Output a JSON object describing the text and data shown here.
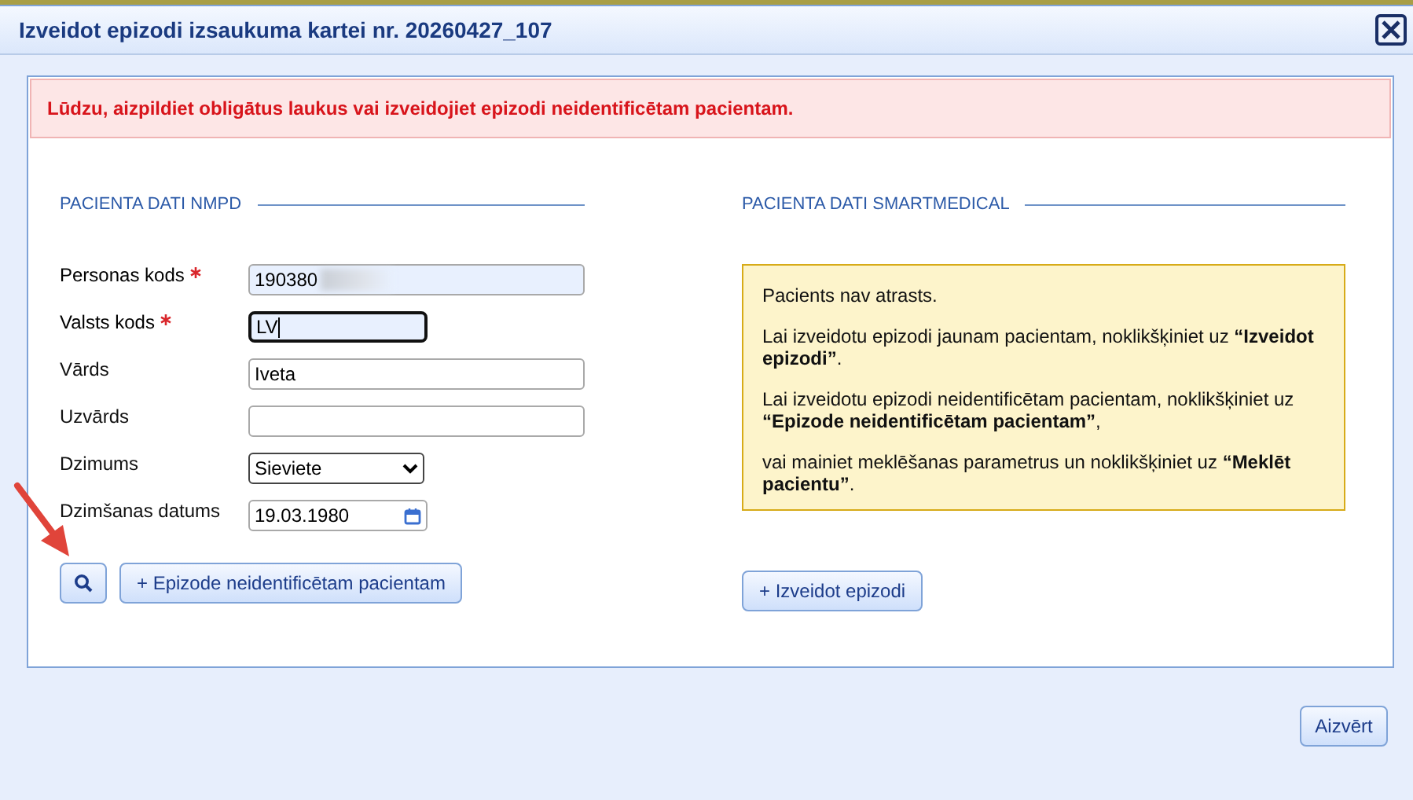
{
  "window": {
    "title": "Izveidot epizodi izsaukuma kartei nr. 20260427_107"
  },
  "alert": "Lūdzu, aizpildiet obligātus laukus vai izveidojiet epizodi neidentificētam pacientam.",
  "nmpd": {
    "heading": "PACIENTA DATI NMPD",
    "fields": [
      {
        "label": "Personas kods",
        "kind": "text",
        "value": "190380",
        "required": true,
        "focused": false,
        "autofilled": true,
        "redacted": true
      },
      {
        "label": "Valsts kods",
        "kind": "text",
        "value": "LV",
        "required": true,
        "focused": true,
        "autofilled": true,
        "redacted": false
      },
      {
        "label": "Vārds",
        "kind": "text",
        "value": "Iveta",
        "required": false,
        "focused": false,
        "autofilled": false,
        "redacted": false
      },
      {
        "label": "Uzvārds",
        "kind": "text",
        "required": false,
        "focused": false,
        "autofilled": false,
        "redacted": false
      },
      {
        "label": "Dzimums",
        "kind": "select",
        "value": "Sieviete",
        "required": false
      },
      {
        "label": "Dzimšanas datums",
        "kind": "date",
        "value": "19.03.1980",
        "required": false
      }
    ],
    "unidentified_button": "+ Epizode neidentificētam pacientam"
  },
  "smartmedical": {
    "heading": "PACIENTA DATI SMARTMEDICAL",
    "messages": [
      "Pacients nav atrasts.",
      "Lai izveidotu epizodi jaunam pacientam, noklikšķiniet uz **“Izveidot epizodi”**.",
      "Lai izveidotu epizodi neidentificētam pacientam, noklikšķiniet uz **“Epizode neidentificētam pacientam”**,",
      "vai mainiet meklēšanas parametrus un noklikšķiniet uz **“Meklēt pacientu”**."
    ],
    "create_button": "+ Izveidot epizodi"
  },
  "footer": {
    "close_button": "Aizvērt"
  }
}
